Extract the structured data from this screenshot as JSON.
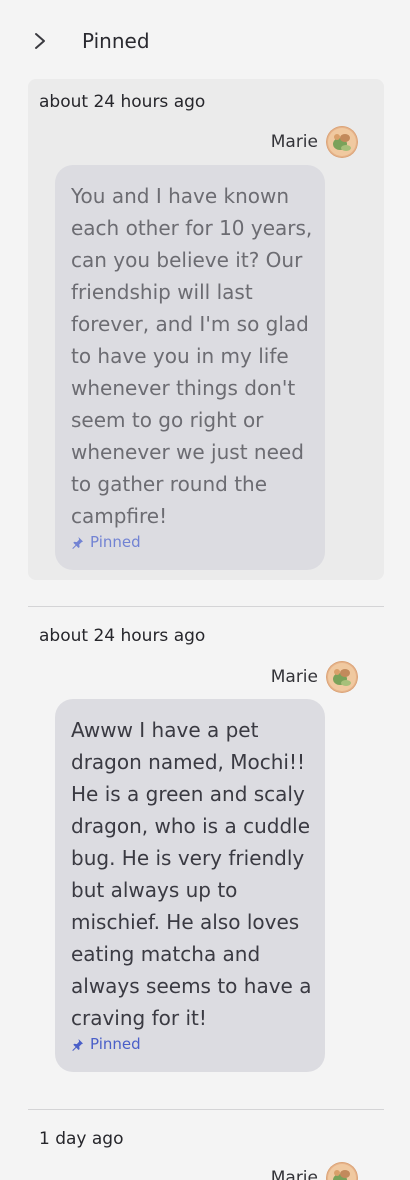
{
  "header": {
    "title": "Pinned",
    "back_icon": "chevron-right-icon"
  },
  "pinned_messages": [
    {
      "timestamp": "about 24 hours ago",
      "author": "Marie",
      "text": "You and I have known each other for 10 years, can you believe it? Our friendship will last forever, and I'm so glad to have you in my life whenever things don't seem to go right or whenever we just need to gather round the campfire!",
      "pinned_label": "Pinned"
    },
    {
      "timestamp": "about 24 hours ago",
      "author": "Marie",
      "text": "Awww I have a pet dragon named, Mochi!! He is a green and scaly dragon, who is a cuddle bug. He is very friendly but always up to mischief. He also loves eating matcha and always seems to have a craving for it!",
      "pinned_label": "Pinned"
    },
    {
      "timestamp": "1 day ago",
      "author": "Marie"
    }
  ],
  "colors": {
    "background": "#f4f4f4",
    "highlight": "#ebebeb",
    "bubble": "#dcdce1",
    "pinned_accent": "#4a5fc8"
  }
}
